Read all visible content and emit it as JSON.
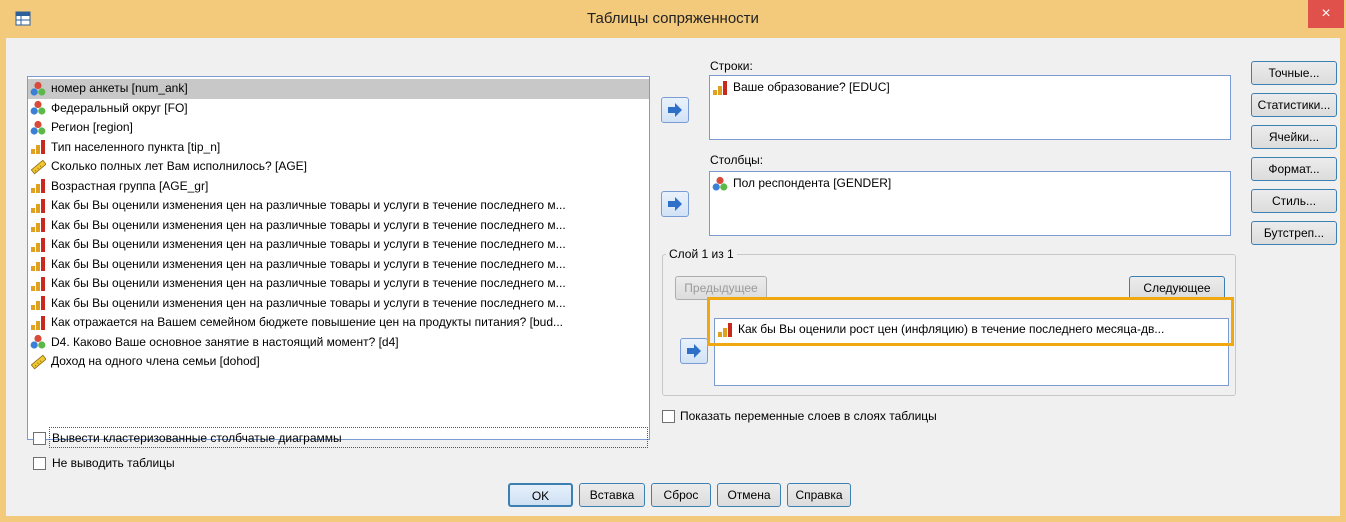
{
  "window": {
    "title": "Таблицы сопряженности",
    "close_label": "×"
  },
  "variables": [
    {
      "label": "номер анкеты [num_ank]",
      "icon": "nominal-icon",
      "selected": true
    },
    {
      "label": "Федеральный округ [FO]",
      "icon": "nominal-icon"
    },
    {
      "label": "Регион [region]",
      "icon": "nominal-icon"
    },
    {
      "label": "Тип населенного пункта [tip_n]",
      "icon": "ordinal-icon"
    },
    {
      "label": "Сколько полных лет Вам исполнилось? [AGE]",
      "icon": "scale-icon"
    },
    {
      "label": "Возрастная группа [AGE_gr]",
      "icon": "ordinal-icon"
    },
    {
      "label": "Как бы Вы оценили изменения цен на различные товары и услуги в течение последнего м...",
      "icon": "ordinal-icon"
    },
    {
      "label": "Как бы Вы оценили изменения цен на различные товары и услуги в течение последнего м...",
      "icon": "ordinal-icon"
    },
    {
      "label": "Как бы Вы оценили изменения цен на различные товары и услуги в течение последнего м...",
      "icon": "ordinal-icon"
    },
    {
      "label": "Как бы Вы оценили изменения цен на различные товары и услуги в течение последнего м...",
      "icon": "ordinal-icon"
    },
    {
      "label": "Как бы Вы оценили изменения цен на различные товары и услуги в течение последнего м...",
      "icon": "ordinal-icon"
    },
    {
      "label": "Как бы Вы оценили изменения цен на различные товары и услуги в течение последнего м...",
      "icon": "ordinal-icon"
    },
    {
      "label": "Как отражается на Вашем семейном бюджете повышение цен на продукты питания? [bud...",
      "icon": "ordinal-icon"
    },
    {
      "label": "D4. Каково Ваше основное занятие в настоящий момент?   [d4]",
      "icon": "nominal-icon"
    },
    {
      "label": "Доход на одного члена семьи [dohod]",
      "icon": "scale-icon"
    }
  ],
  "rows": {
    "label": "Строки:",
    "items": [
      {
        "label": "Ваше образование? [EDUC]",
        "icon": "ordinal-icon"
      }
    ]
  },
  "columns": {
    "label": "Столбцы:",
    "items": [
      {
        "label": "Пол респондента [GENDER]",
        "icon": "nominal-icon"
      }
    ]
  },
  "layer": {
    "label": "Слой 1 из 1",
    "prev_label": "Предыдущее",
    "next_label": "Следующее",
    "items": [
      {
        "label": "Как бы Вы оценили рост цен (инфляцию) в течение последнего месяца-дв...",
        "icon": "ordinal-icon"
      }
    ]
  },
  "side_buttons": [
    "Точные...",
    "Статистики...",
    "Ячейки...",
    "Формат...",
    "Стиль...",
    "Бутстреп..."
  ],
  "options": {
    "show_layer_vars": "Показать переменные слоев в слоях таблицы",
    "clustered_bars": "Вывести кластеризованные столбчатые диаграммы",
    "suppress_tables": "Не выводить таблицы"
  },
  "footer": {
    "ok": "OK",
    "paste": "Вставка",
    "reset": "Сброс",
    "cancel": "Отмена",
    "help": "Справка"
  },
  "colors": {
    "title_bar": "#f3c97c",
    "highlight": "#f0a810",
    "close": "#e0514c"
  }
}
